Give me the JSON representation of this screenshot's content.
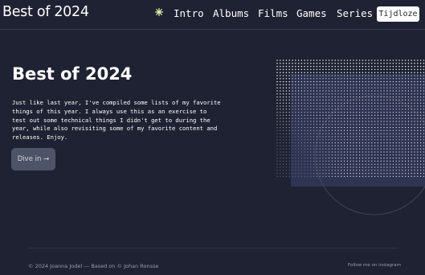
{
  "header": {
    "brand": "Best of 2024",
    "nav": [
      "Intro",
      "Albums",
      "Films",
      "Games",
      "Series"
    ],
    "cta_button": "Tijdloze",
    "star_color": "#e9f0a8"
  },
  "hero": {
    "title": "Best of 2024",
    "intro": "Just like last year, I've compiled some lists of my favorite things of this year. I always use this as an exercise to test out some technical things I didn't get to during the year, while also revisiting some of my favorite content and releases. Enjoy.",
    "button": "Dive in →"
  },
  "footer": {
    "left": "© 2024 Joanna Jodel --- Based on © Johan Ronsse",
    "right": "Follow me on instagram"
  },
  "colors": {
    "background": "#1f2232",
    "accent_panel": "#2e3452",
    "button_bg": "#4e5467"
  }
}
